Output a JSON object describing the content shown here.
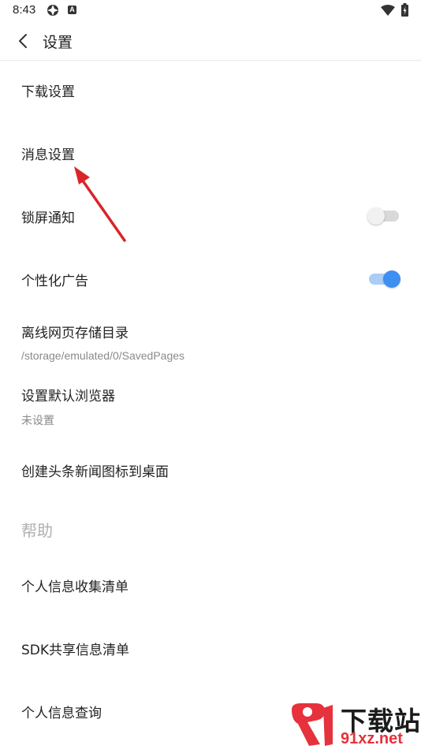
{
  "status": {
    "time": "8:43",
    "badge_letter": "A"
  },
  "header": {
    "title": "设置"
  },
  "settings": [
    {
      "label": "下载设置"
    },
    {
      "label": "消息设置"
    },
    {
      "label": "锁屏通知",
      "toggle": "off"
    },
    {
      "label": "个性化广告",
      "toggle": "on"
    },
    {
      "label": "离线网页存储目录",
      "value": "/storage/emulated/0/SavedPages"
    },
    {
      "label": "设置默认浏览器",
      "value": "未设置"
    },
    {
      "label": "创建头条新闻图标到桌面"
    }
  ],
  "help": {
    "header": "帮助",
    "items": [
      {
        "label": "个人信息收集清单"
      },
      {
        "label": "SDK共享信息清单"
      },
      {
        "label": "个人信息查询"
      }
    ]
  },
  "watermark": {
    "text": "下载站",
    "url": "91xz.net"
  },
  "colors": {
    "accent": "#3d8ff0",
    "annotation_arrow": "#d9252a",
    "watermark_red": "#e5323c"
  }
}
